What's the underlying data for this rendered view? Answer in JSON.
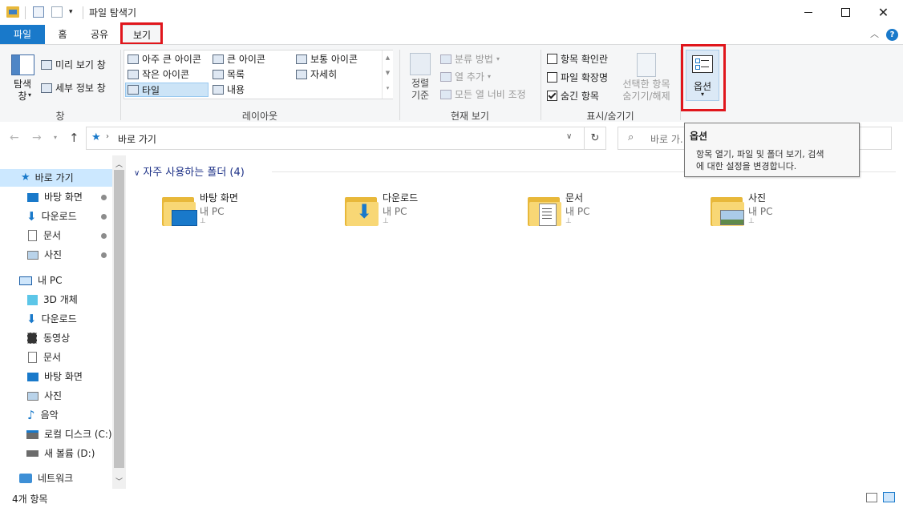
{
  "window": {
    "title": "파일 탐색기"
  },
  "tabs": {
    "file": "파일",
    "home": "홈",
    "share": "공유",
    "view": "보기"
  },
  "ribbon": {
    "panes": {
      "nav_pane": "탐색\n창",
      "preview": "미리 보기 창",
      "details": "세부 정보 창",
      "group": "창"
    },
    "layout": {
      "items": [
        "아주 큰 아이콘",
        "큰 아이콘",
        "보통 아이콘",
        "작은 아이콘",
        "목록",
        "자세히",
        "타일",
        "내용"
      ],
      "group": "레이아웃"
    },
    "current_view": {
      "sort": "정렬\n기준",
      "group_by": "분류 방법",
      "add_columns": "열 추가",
      "fit_columns": "모든 열 너비 조정",
      "group": "현재 보기"
    },
    "show_hide": {
      "item_checkboxes": "항목 확인란",
      "file_extensions": "파일 확장명",
      "hidden_items": "숨긴 항목",
      "hide_selected": "선택한 항목\n숨기기/해제",
      "group": "표시/숨기기"
    },
    "options": {
      "label": "옵션"
    }
  },
  "address": {
    "path": "바로 가기",
    "search_placeholder": "바로 가..."
  },
  "tooltip": {
    "title": "옵션",
    "body": "항목 열기, 파일 및 폴더 보기, 검색\n에 대한 설정을 변경합니다."
  },
  "nav": {
    "quick_access": "바로 가기",
    "quick_items": [
      "바탕 화면",
      "다운로드",
      "문서",
      "사진"
    ],
    "this_pc": "내 PC",
    "pc_items": [
      "3D 개체",
      "다운로드",
      "동영상",
      "문서",
      "바탕 화면",
      "사진",
      "음악",
      "로컬 디스크 (C:)",
      "새 볼륨 (D:)"
    ],
    "network": "네트워크"
  },
  "content": {
    "section_header": "자주 사용하는 폴더 (4)",
    "folders": [
      {
        "name": "바탕 화면",
        "location": "내 PC"
      },
      {
        "name": "다운로드",
        "location": "내 PC"
      },
      {
        "name": "문서",
        "location": "내 PC"
      },
      {
        "name": "사진",
        "location": "내 PC"
      }
    ]
  },
  "status": {
    "count": "4개 항목"
  },
  "colors": {
    "accent": "#1979ca",
    "highlight": "#e0161c",
    "folder": "#f8d775"
  }
}
